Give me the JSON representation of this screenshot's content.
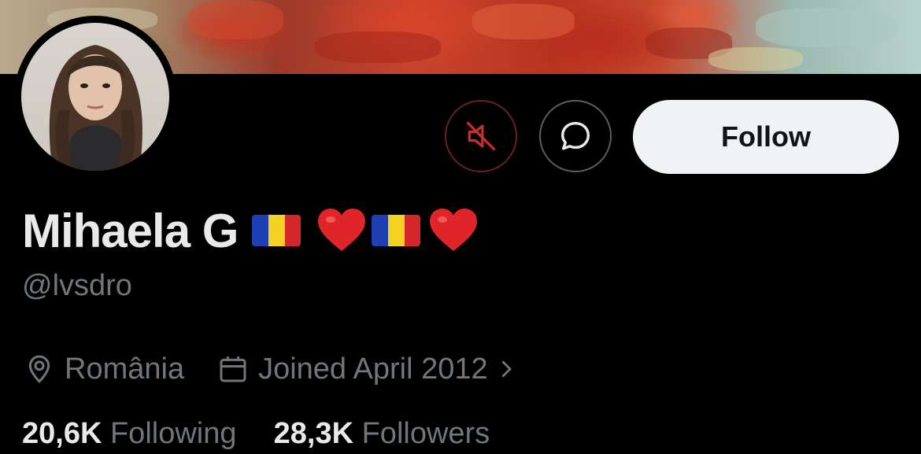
{
  "profile": {
    "display_name": "Mihaela G",
    "name_emojis": [
      "romania-flag",
      "red-heart",
      "romania-flag",
      "red-heart"
    ],
    "handle": "@lvsdro",
    "location": "România",
    "joined": "Joined April 2012",
    "following_count": "20,6K",
    "following_label": "Following",
    "followers_count": "28,3K",
    "followers_label": "Followers"
  },
  "actions": {
    "mute_icon": "muted-speaker-icon",
    "message_icon": "message-bubble-icon",
    "follow_label": "Follow"
  },
  "colors": {
    "background": "#000000",
    "muted_accent": "#c4302b",
    "secondary_text": "#71767b",
    "follow_button_bg": "#eff3f4"
  }
}
